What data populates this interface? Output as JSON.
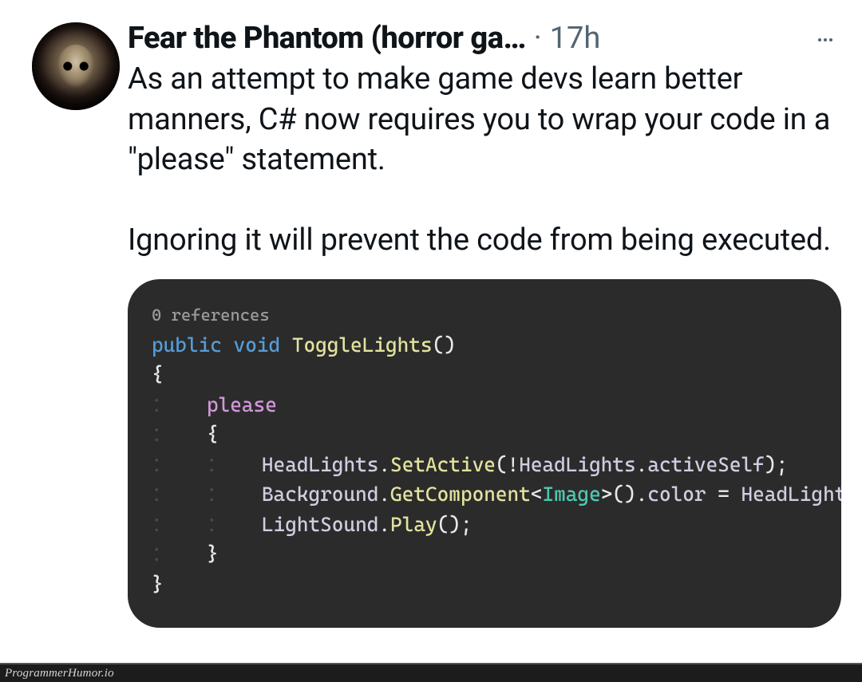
{
  "tweet": {
    "author_name": "Fear the Phantom (horror ga…",
    "separator": "·",
    "timestamp": "17h",
    "body_paragraphs": [
      "As an attempt to make game devs learn better manners, C# now requires you to wrap your code in a \"please\" statement.",
      "Ignoring it will prevent the code from being executed."
    ]
  },
  "code": {
    "references_label": "0 references",
    "tokens": {
      "public": "public",
      "void": "void",
      "fn_name": "ToggleLights",
      "please": "please",
      "headlights": "HeadLights",
      "set_active": "SetActive",
      "active_self": "activeSelf",
      "background": "Background",
      "get_component": "GetComponent",
      "image_type": "Image",
      "color": "color",
      "headlight_cut": "HeadLight",
      "lightsound": "LightSound",
      "play": "Play"
    }
  },
  "footer": {
    "watermark": "ProgrammerHumor.io"
  }
}
